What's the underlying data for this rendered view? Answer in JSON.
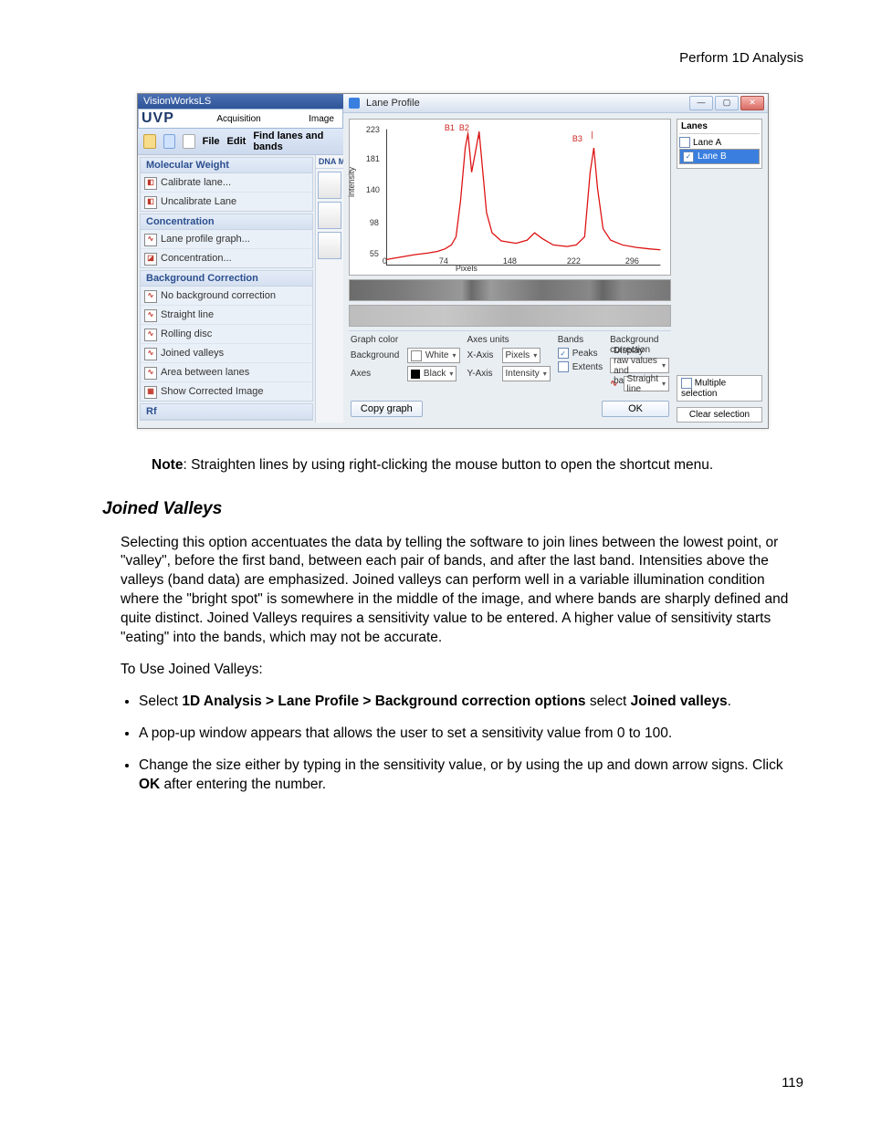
{
  "header": {
    "title": "Perform 1D Analysis"
  },
  "app": {
    "titlebar": "VisionWorksLS",
    "logo": "UVP",
    "logo_tabs": [
      "Acquisition",
      "Image"
    ],
    "toolbar": {
      "file": "File",
      "edit": "Edit",
      "find": "Find lanes and bands"
    },
    "mini_label": "DNA Monochro",
    "panels": [
      {
        "title": "Molecular Weight",
        "items": [
          "Calibrate lane...",
          "Uncalibrate Lane"
        ]
      },
      {
        "title": "Concentration",
        "items": [
          "Lane profile graph...",
          "Concentration..."
        ]
      },
      {
        "title": "Background Correction",
        "items": [
          "No background correction",
          "Straight line",
          "Rolling disc",
          "Joined valleys",
          "Area between lanes",
          "Show Corrected Image"
        ]
      },
      {
        "title": "Rf",
        "items": []
      }
    ]
  },
  "dialog": {
    "title": "Lane Profile",
    "lanes": {
      "header": "Lanes",
      "items": [
        "Lane A",
        "Lane B"
      ],
      "selected": 1
    },
    "multiple": "Multiple selection",
    "clear": "Clear selection",
    "controls": {
      "graph_color": "Graph color",
      "axes_units": "Axes units",
      "bands": "Bands",
      "bg_corr": "Background correction",
      "bg_label": "Background",
      "bg_value": "White",
      "axes_label": "Axes",
      "axes_value": "Black",
      "xaxis_label": "X-Axis",
      "xaxis_value": "Pixels",
      "yaxis_label": "Y-Axis",
      "yaxis_value": "Intensity",
      "peaks": "Peaks",
      "extents": "Extents",
      "raw": "Display raw values and baseline",
      "straight": "Straight line"
    },
    "copy_btn": "Copy graph",
    "ok_btn": "OK"
  },
  "chart_data": {
    "type": "line",
    "title": "",
    "xlabel": "Pixels",
    "ylabel": "intensity",
    "xlim": [
      0,
      296
    ],
    "ylim": [
      55,
      223
    ],
    "xticks": [
      0,
      74,
      148,
      222,
      296
    ],
    "yticks": [
      55,
      98,
      140,
      181,
      223
    ],
    "annotations": [
      {
        "label": "B1",
        "x": 88
      },
      {
        "label": "B2",
        "x": 100
      },
      {
        "label": "B3",
        "x": 222
      }
    ],
    "series": [
      {
        "name": "Lane B",
        "color": "#d11",
        "points": [
          [
            0,
            62
          ],
          [
            15,
            65
          ],
          [
            30,
            68
          ],
          [
            45,
            70
          ],
          [
            55,
            72
          ],
          [
            63,
            75
          ],
          [
            70,
            80
          ],
          [
            75,
            90
          ],
          [
            80,
            135
          ],
          [
            85,
            200
          ],
          [
            88,
            218
          ],
          [
            92,
            170
          ],
          [
            96,
            195
          ],
          [
            100,
            220
          ],
          [
            104,
            170
          ],
          [
            108,
            120
          ],
          [
            114,
            95
          ],
          [
            124,
            85
          ],
          [
            140,
            82
          ],
          [
            152,
            86
          ],
          [
            160,
            95
          ],
          [
            168,
            88
          ],
          [
            180,
            80
          ],
          [
            195,
            78
          ],
          [
            205,
            80
          ],
          [
            214,
            90
          ],
          [
            220,
            170
          ],
          [
            224,
            200
          ],
          [
            228,
            150
          ],
          [
            234,
            100
          ],
          [
            242,
            86
          ],
          [
            255,
            80
          ],
          [
            270,
            77
          ],
          [
            285,
            75
          ],
          [
            296,
            74
          ]
        ]
      }
    ]
  },
  "doc": {
    "note_label": "Note",
    "note_text": ":   Straighten lines by using right-clicking the mouse button to open the shortcut menu.",
    "section_title": "Joined Valleys",
    "para1": "Selecting this option accentuates the data by telling the software to join lines between the lowest point, or \"valley\", before the first band, between each pair of bands, and after the last band. Intensities above the valleys (band data) are emphasized. Joined valleys can perform well in a variable illumination condition where the \"bright spot\" is somewhere in the middle of the image, and where bands are sharply defined and quite distinct. Joined Valleys requires a sensitivity value to be entered. A higher value of sensitivity starts \"eating\" into the bands, which may not be accurate.",
    "para2": "To Use Joined Valleys:",
    "li1_pre": "Select ",
    "li1_bold1": "1D Analysis > Lane Profile > Background correction options",
    "li1_mid": " select ",
    "li1_bold2": "Joined valleys",
    "li2": "A pop-up window appears that allows the user to set a sensitivity value from 0 to 100.",
    "li3a": "Change the size either by typing in the sensitivity value, or by using the up and down arrow signs. Click ",
    "li3b": "OK",
    "li3c": " after entering the number."
  },
  "page_number": "119"
}
